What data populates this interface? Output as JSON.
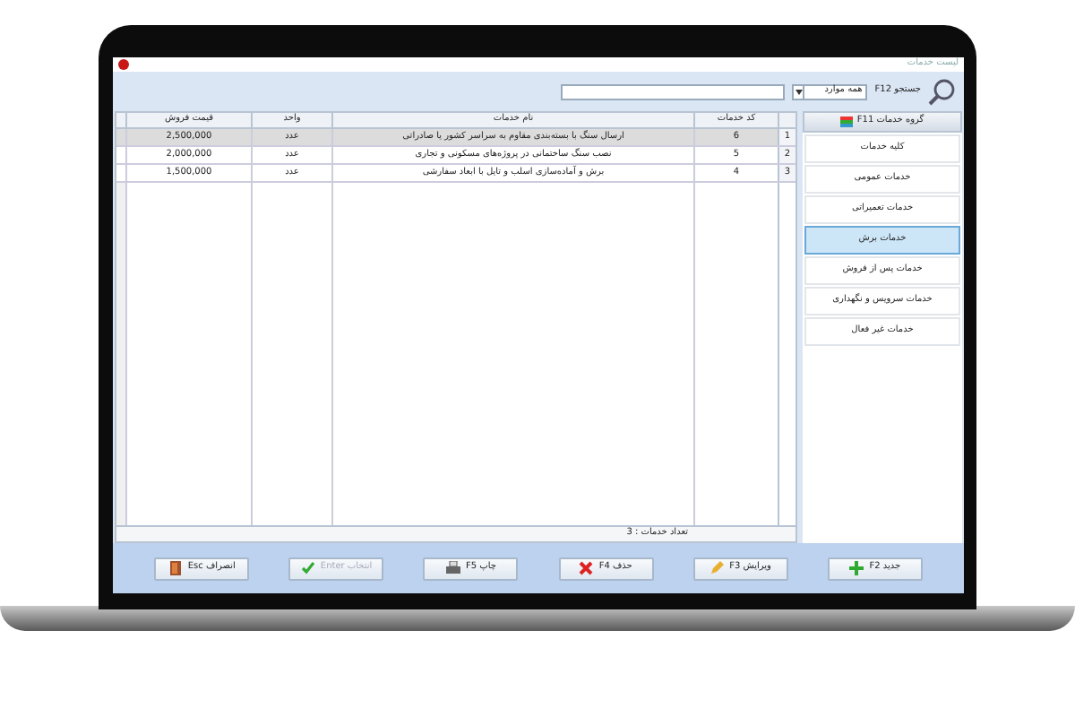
{
  "window": {
    "title": "لیست خدمات"
  },
  "search": {
    "label": "جستجو F12",
    "scope": "همه موارد"
  },
  "sidebar": {
    "title": "گروه خدمات F11",
    "items": [
      {
        "label": "کلیه خدمات",
        "selected": false
      },
      {
        "label": "خدمات عمومی",
        "selected": false
      },
      {
        "label": "خدمات تعمیراتی",
        "selected": false
      },
      {
        "label": "خدمات برش",
        "selected": true
      },
      {
        "label": "خدمات پس از فروش",
        "selected": false
      },
      {
        "label": "خدمات سرویس و نگهداری",
        "selected": false
      },
      {
        "label": "خدمات غیر فعال",
        "selected": false
      }
    ]
  },
  "table": {
    "columns": [
      "کد خدمات",
      "نام خدمات",
      "واحد",
      "قیمت فروش"
    ],
    "rows": [
      {
        "index": "1",
        "selected": true,
        "cells": [
          "6",
          "ارسال سنگ با بسته‌بندی مقاوم به سراسر کشور یا صادراتی",
          "عدد",
          "2,500,000"
        ]
      },
      {
        "index": "2",
        "selected": false,
        "cells": [
          "5",
          "نصب سنگ ساختمانی در پروژه‌های مسکونی و تجاری",
          "عدد",
          "2,000,000"
        ]
      },
      {
        "index": "3",
        "selected": false,
        "cells": [
          "4",
          "برش و آماده‌سازی اسلب و تایل با ابعاد سفارشی",
          "عدد",
          "1,500,000"
        ]
      }
    ]
  },
  "status_bar": {
    "count": "تعداد خدمات : 3"
  },
  "buttons": [
    {
      "kind": "new",
      "label": "جدید F2",
      "disabled": false
    },
    {
      "kind": "edit",
      "label": "ویرایش F3",
      "disabled": false
    },
    {
      "kind": "delete",
      "label": "حذف F4",
      "disabled": false
    },
    {
      "kind": "print",
      "label": "چاپ F5",
      "disabled": false
    },
    {
      "kind": "select",
      "label": "انتخاب Enter",
      "disabled": true
    },
    {
      "kind": "cancel",
      "label": "انصراف Esc",
      "disabled": false
    }
  ]
}
